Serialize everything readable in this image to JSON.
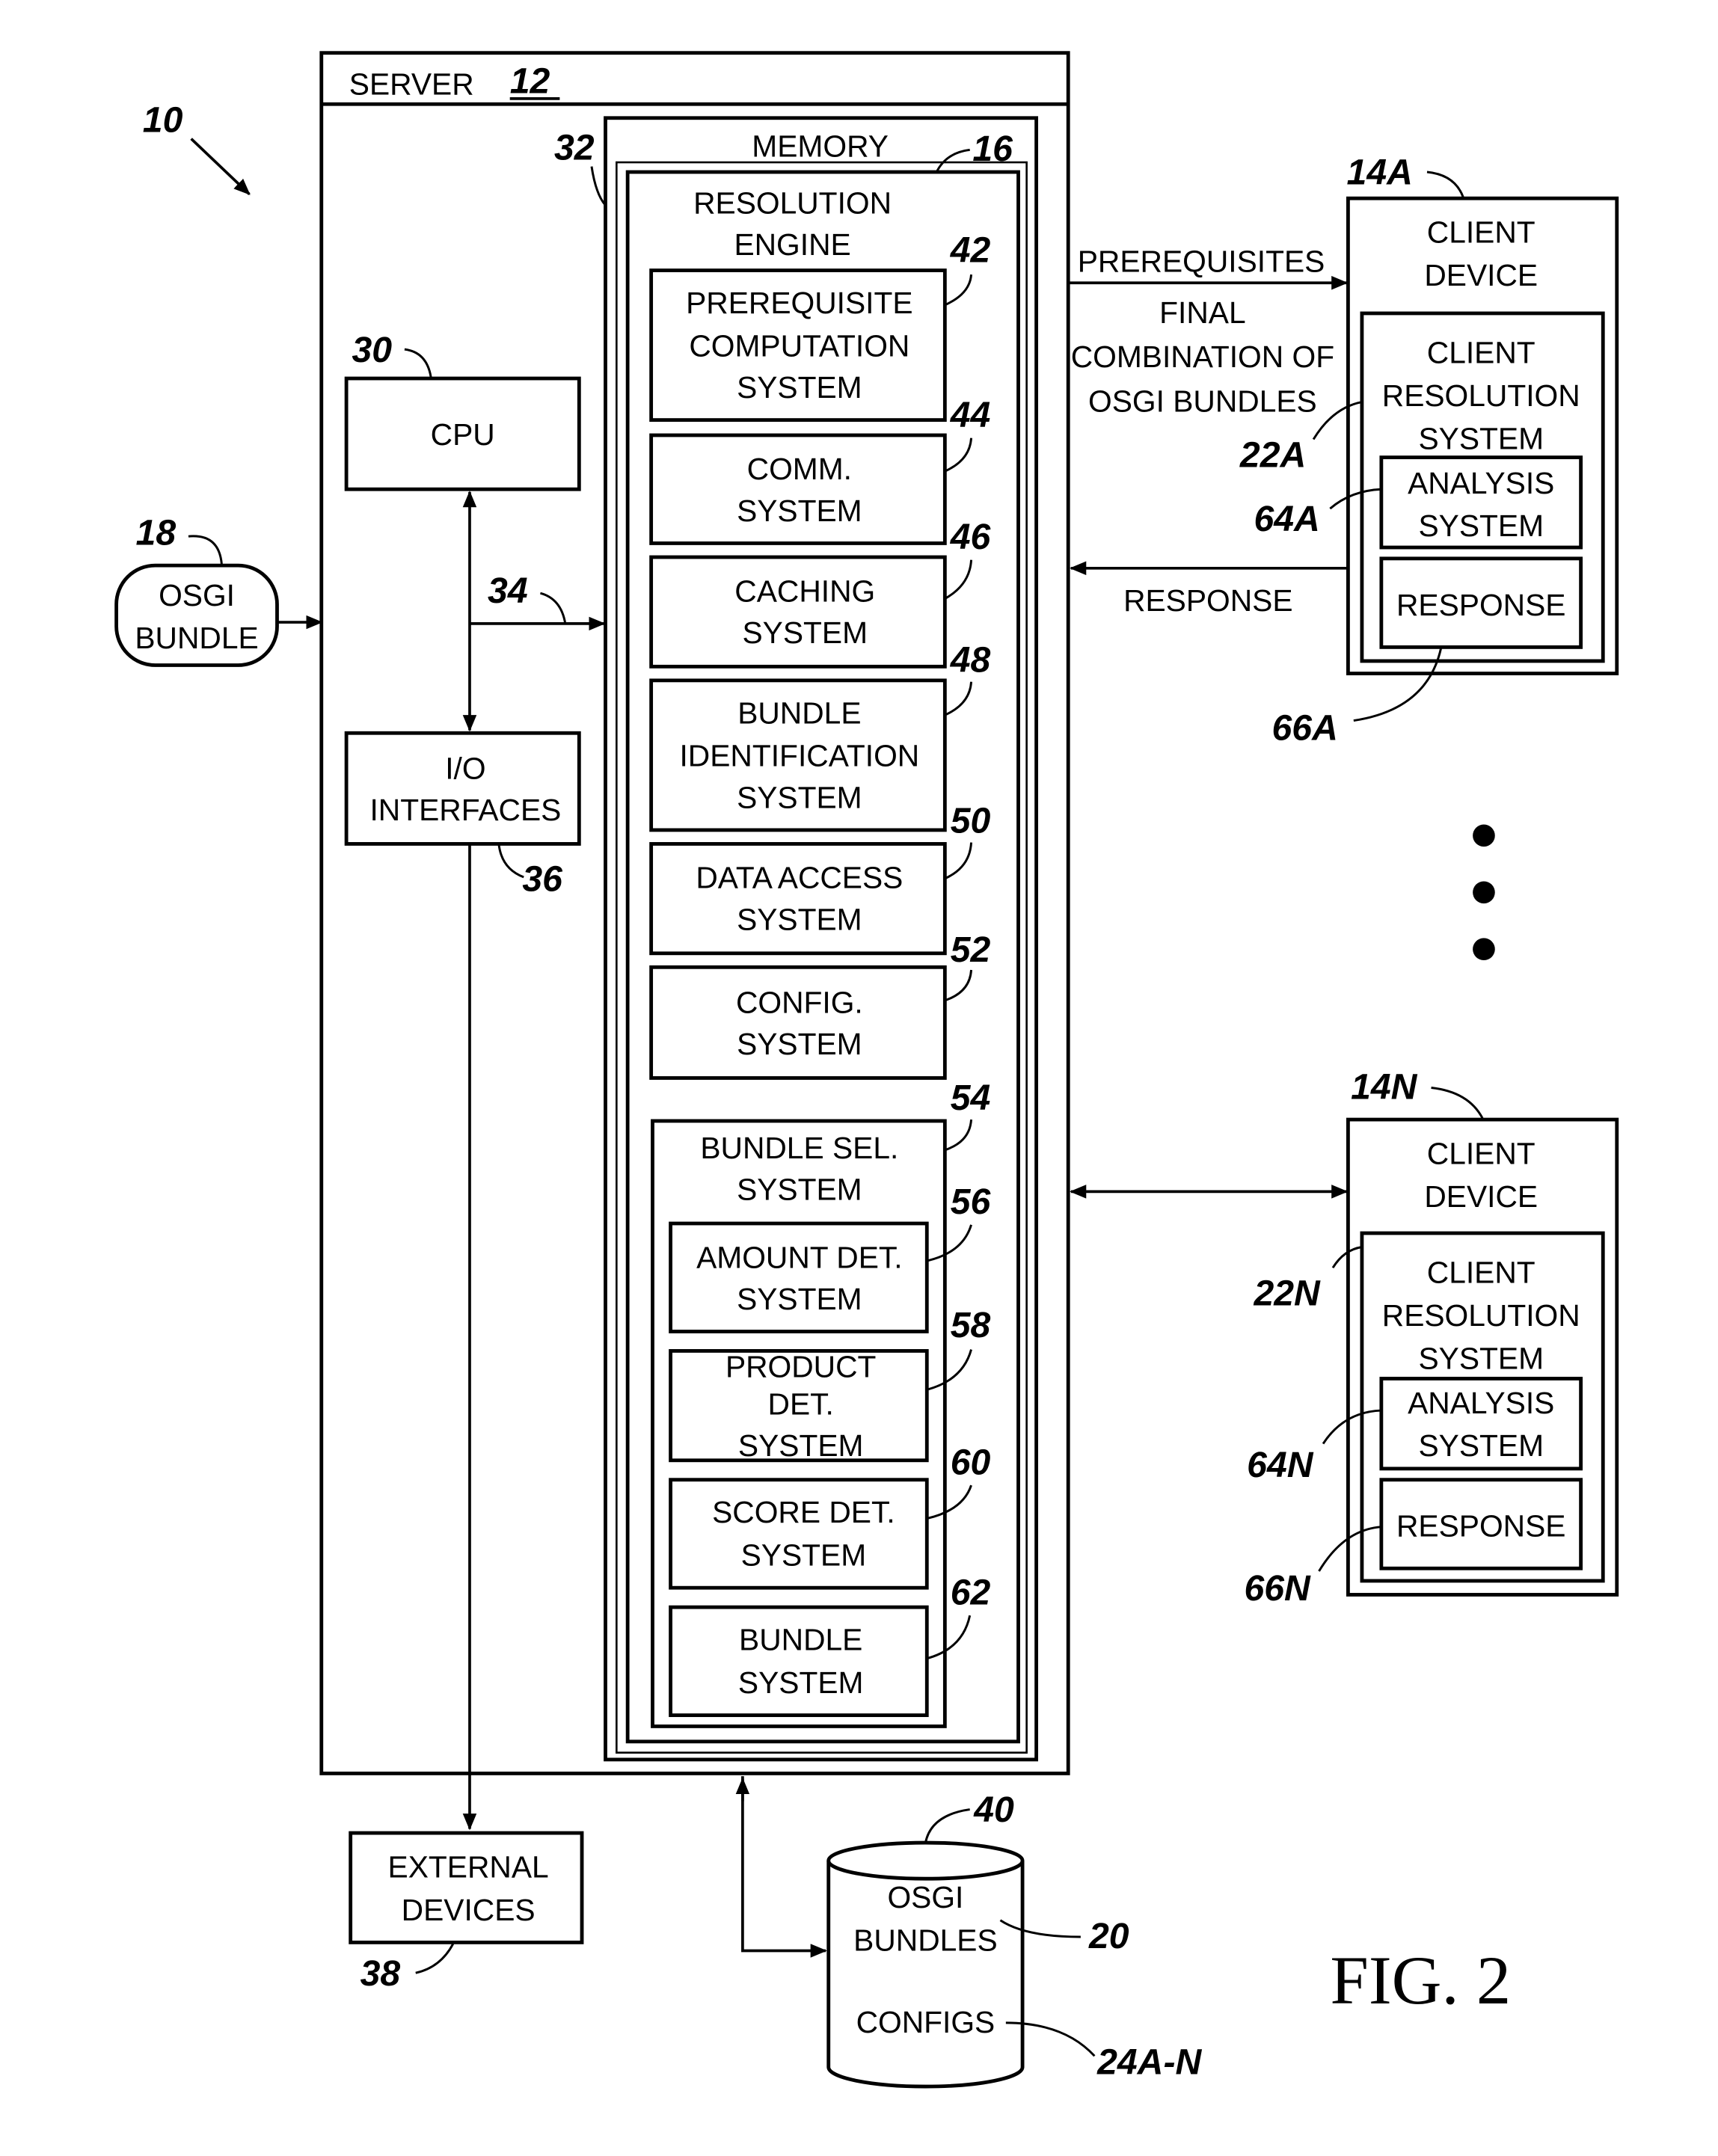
{
  "figure": {
    "title": "FIG. 2",
    "system_ref": "10"
  },
  "server": {
    "label": "SERVER",
    "ref": "12"
  },
  "memory": {
    "label": "MEMORY",
    "ref": "32",
    "engine_ref": "16",
    "engine_label_line1": "RESOLUTION",
    "engine_label_line2": "ENGINE"
  },
  "cpu": {
    "label": "CPU",
    "ref": "30"
  },
  "bus": {
    "ref": "34"
  },
  "io": {
    "label_line1": "I/O",
    "label_line2": "INTERFACES",
    "ref": "36"
  },
  "osgi_bundle": {
    "label_line1": "OSGI",
    "label_line2": "BUNDLE",
    "ref": "18"
  },
  "external_devices": {
    "label_line1": "EXTERNAL",
    "label_line2": "DEVICES",
    "ref": "38"
  },
  "storage": {
    "ref": "40",
    "bundles_line1": "OSGI",
    "bundles_line2": "BUNDLES",
    "bundles_ref": "20",
    "configs_label": "CONFIGS",
    "configs_ref": "24A-N"
  },
  "engine_systems": [
    {
      "lines": [
        "PREREQUISITE",
        "COMPUTATION",
        "SYSTEM"
      ],
      "ref": "42"
    },
    {
      "lines": [
        "COMM.",
        "SYSTEM"
      ],
      "ref": "44"
    },
    {
      "lines": [
        "CACHING",
        "SYSTEM"
      ],
      "ref": "46"
    },
    {
      "lines": [
        "BUNDLE",
        "IDENTIFICATION",
        "SYSTEM"
      ],
      "ref": "48"
    },
    {
      "lines": [
        "DATA ACCESS",
        "SYSTEM"
      ],
      "ref": "50"
    },
    {
      "lines": [
        "CONFIG.",
        "SYSTEM"
      ],
      "ref": "52"
    }
  ],
  "bundle_selection": {
    "lines": [
      "BUNDLE SEL.",
      "SYSTEM"
    ],
    "ref": "54",
    "subsystems": [
      {
        "lines": [
          "AMOUNT DET.",
          "SYSTEM"
        ],
        "ref": "56"
      },
      {
        "lines": [
          "PRODUCT",
          "DET.",
          "SYSTEM"
        ],
        "ref": "58"
      },
      {
        "lines": [
          "SCORE DET.",
          "SYSTEM"
        ],
        "ref": "60"
      },
      {
        "lines": [
          "BUNDLE",
          "SYSTEM"
        ],
        "ref": "62"
      }
    ]
  },
  "flows": {
    "prerequisites": "PREREQUISITES",
    "final_line1": "FINAL",
    "final_line2": "COMBINATION OF",
    "final_line3": "OSGI BUNDLES",
    "response": "RESPONSE"
  },
  "clients": [
    {
      "device_line1": "CLIENT",
      "device_line2": "DEVICE",
      "device_ref": "14A",
      "crs_lines": [
        "CLIENT",
        "RESOLUTION",
        "SYSTEM"
      ],
      "crs_ref": "22A",
      "analysis_lines": [
        "ANALYSIS",
        "SYSTEM"
      ],
      "analysis_ref": "64A",
      "response_label": "RESPONSE",
      "response_ref": "66A"
    },
    {
      "device_line1": "CLIENT",
      "device_line2": "DEVICE",
      "device_ref": "14N",
      "crs_lines": [
        "CLIENT",
        "RESOLUTION",
        "SYSTEM"
      ],
      "crs_ref": "22N",
      "analysis_lines": [
        "ANALYSIS",
        "SYSTEM"
      ],
      "analysis_ref": "64N",
      "response_label": "RESPONSE",
      "response_ref": "66N"
    }
  ]
}
